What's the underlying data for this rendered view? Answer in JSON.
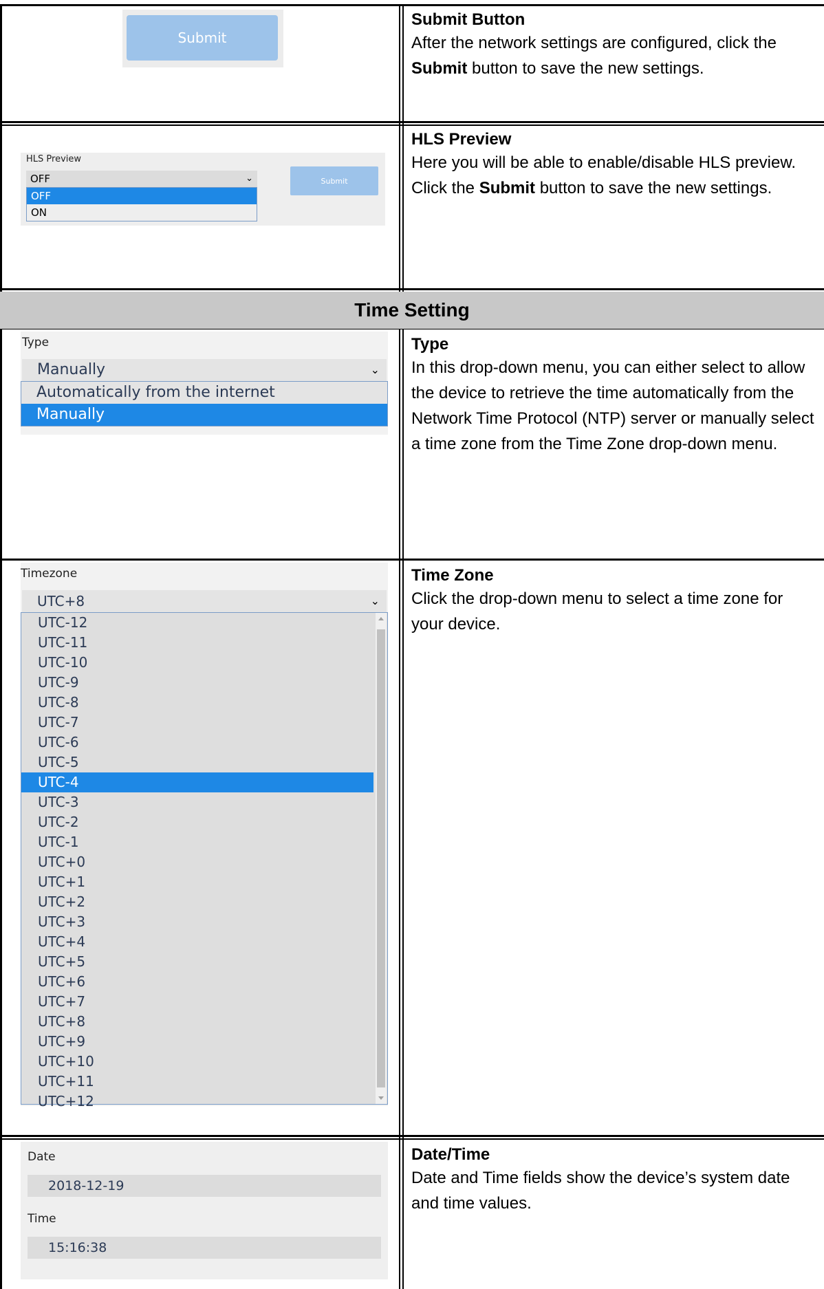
{
  "rows": {
    "submit": {
      "title": "Submit Button",
      "text_before": "After the network settings are configured, click the ",
      "bold": "Submit",
      "text_after": " button to save the new settings.",
      "button_label": "Submit"
    },
    "hls": {
      "title": "HLS Preview",
      "text_before": "Here you will be able to enable/disable HLS preview. Click the ",
      "bold": "Submit",
      "text_after": " button to save the new settings.",
      "field_label": "HLS Preview",
      "selected": "OFF",
      "options": [
        "OFF",
        "ON"
      ],
      "button_label": "Submit"
    },
    "type": {
      "title": "Type",
      "text": "In this drop-down menu, you can either select to allow the device to retrieve the time automatically from the Network Time Protocol (NTP) server or manually select a time zone from the Time Zone drop-down menu.",
      "field_label": "Type",
      "selected": "Manually",
      "options": [
        "Automatically from the internet",
        "Manually"
      ]
    },
    "timezone": {
      "title": "Time Zone",
      "text": "Click the drop-down menu to select a time zone for your device.",
      "field_label": "Timezone",
      "selected": "UTC+8",
      "highlighted": "UTC-4",
      "options": [
        "UTC-12",
        "UTC-11",
        "UTC-10",
        "UTC-9",
        "UTC-8",
        "UTC-7",
        "UTC-6",
        "UTC-5",
        "UTC-4",
        "UTC-3",
        "UTC-2",
        "UTC-1",
        "UTC+0",
        "UTC+1",
        "UTC+2",
        "UTC+3",
        "UTC+4",
        "UTC+5",
        "UTC+6",
        "UTC+7",
        "UTC+8",
        "UTC+9",
        "UTC+10",
        "UTC+11",
        "UTC+12"
      ]
    },
    "datetime": {
      "title": "Date/Time",
      "text": "Date and Time fields show the device’s system date and time values.",
      "date_label": "Date",
      "date_value": "2018-12-19",
      "time_label": "Time",
      "time_value": "15:16:38"
    }
  },
  "section_header": "Time Setting",
  "colors": {
    "accent": "#1e88e5",
    "button": "#9dc3ea",
    "header_band": "#c8c8c8"
  }
}
